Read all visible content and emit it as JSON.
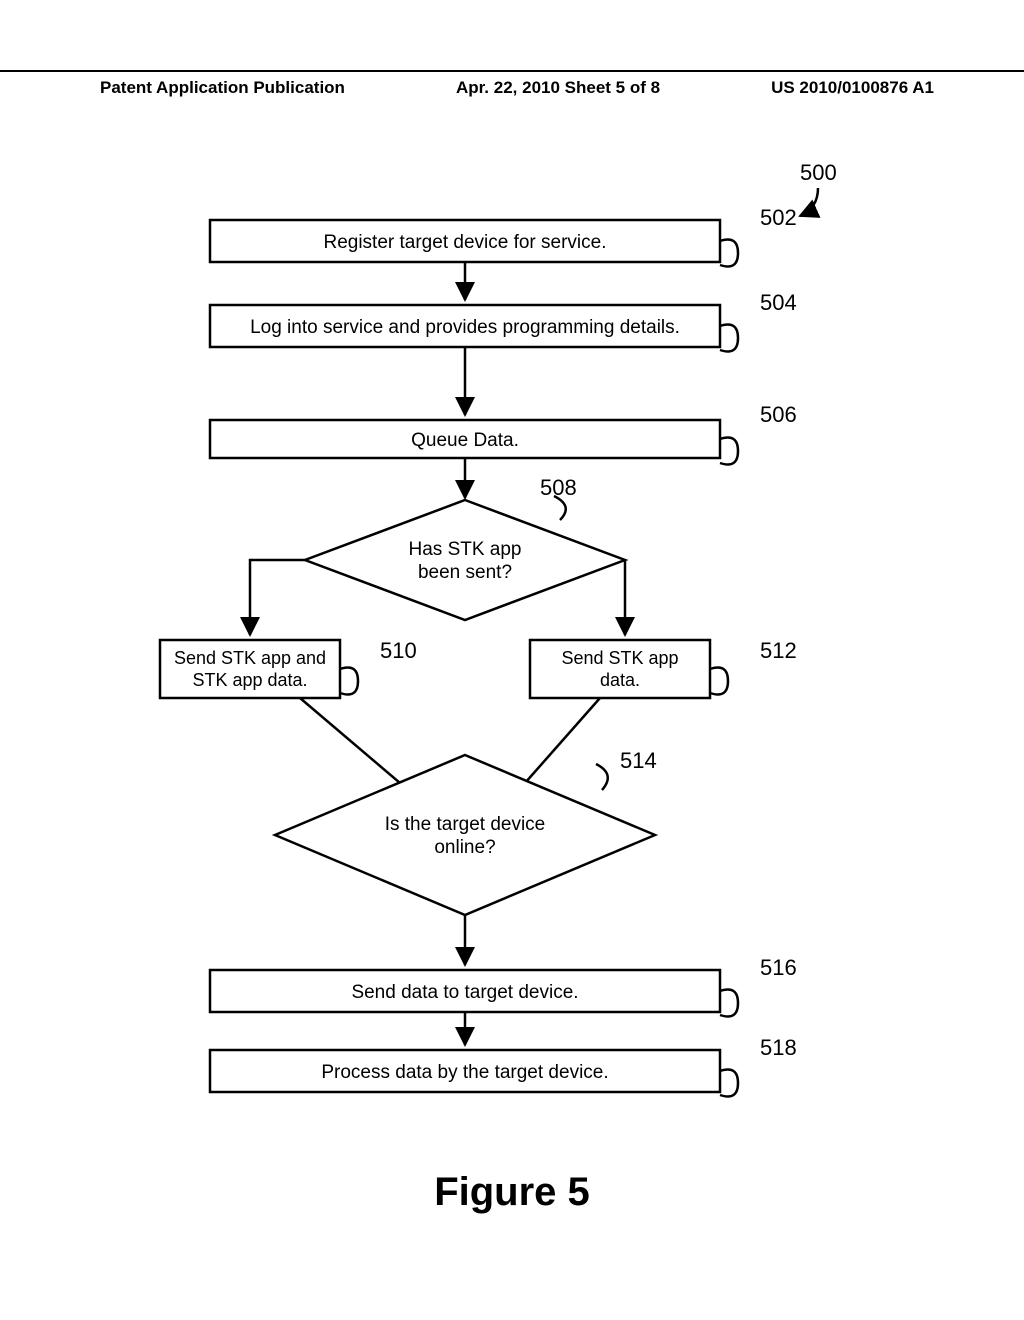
{
  "header": {
    "left": "Patent Application Publication",
    "center": "Apr. 22, 2010  Sheet 5 of 8",
    "right": "US 2010/0100876 A1"
  },
  "figure_caption": "Figure 5",
  "boxes": {
    "b502": "Register target device for service.",
    "b504": "Log into service and provides programming details.",
    "b506": "Queue Data.",
    "d508_l1": "Has STK app",
    "d508_l2": "been sent?",
    "b510_l1": "Send STK app and",
    "b510_l2": "STK app data.",
    "b512_l1": "Send STK app",
    "b512_l2": "data.",
    "d514_l1": "Is the target device",
    "d514_l2": "online?",
    "b516": "Send data to target device.",
    "b518": "Process data by the target device."
  },
  "labels": {
    "l500": "500",
    "l502": "502",
    "l504": "504",
    "l506": "506",
    "l508": "508",
    "l510": "510",
    "l512": "512",
    "l514": "514",
    "l516": "516",
    "l518": "518"
  }
}
